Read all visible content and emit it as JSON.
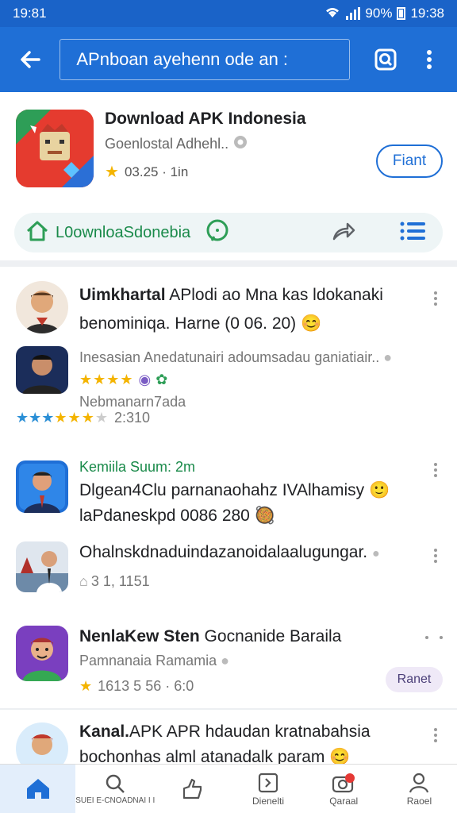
{
  "status": {
    "time_left": "19:81",
    "battery": "90%",
    "time_right": "19:38"
  },
  "appbar": {
    "search_text": "APnboan ayehenn ode an :"
  },
  "hero": {
    "title": "Download APK Indonesia",
    "developer": "Goenlostal Adhehl..",
    "rating": "03.25 · 1in",
    "install_label": "Fiant",
    "link_label": "L0ownloaSdonebia"
  },
  "feed": [
    {
      "line1_bold": "Uimkhartal",
      "line1": " APlodi ao Mna kas ldokanaki",
      "line2": "benominiqa. Harne (0 06. 20) 😊"
    },
    {
      "sub": "Inesasian Anedatunairi adoumsadau ganiatiair..",
      "tag1": "Nebmanarn7ada",
      "rating": "2:310"
    },
    {
      "meta": "Kemiila Suum: 2m",
      "line1": "Dlgean4Clu parnanaohahz IVAlhamisy 🙂",
      "line2": "laPdaneskpd 0086 280 🥘"
    },
    {
      "line1": "Ohalnskdnaduindazanoidalaalugungar.",
      "rating": "3  1, 1151"
    },
    {
      "line1_bold": "NenlaKew Sten",
      "line1": " Gocnanide Baraila",
      "sub": "Pamnanaia Ramamia",
      "rating": "1613 5 56 · 6:0",
      "tag": "Ranet"
    },
    {
      "line1_bold": "Kanal.",
      "line1": "APK APR hdaudan kratnabahsia",
      "line2": "bochonhas alml atanadalk param 😊"
    }
  ],
  "nav": [
    {
      "label": ""
    },
    {
      "label": "SUEI E-CNOADNAI I I"
    },
    {
      "label": ""
    },
    {
      "label": "Dienelti"
    },
    {
      "label": "Qaraal"
    },
    {
      "label": "Raoel"
    }
  ]
}
